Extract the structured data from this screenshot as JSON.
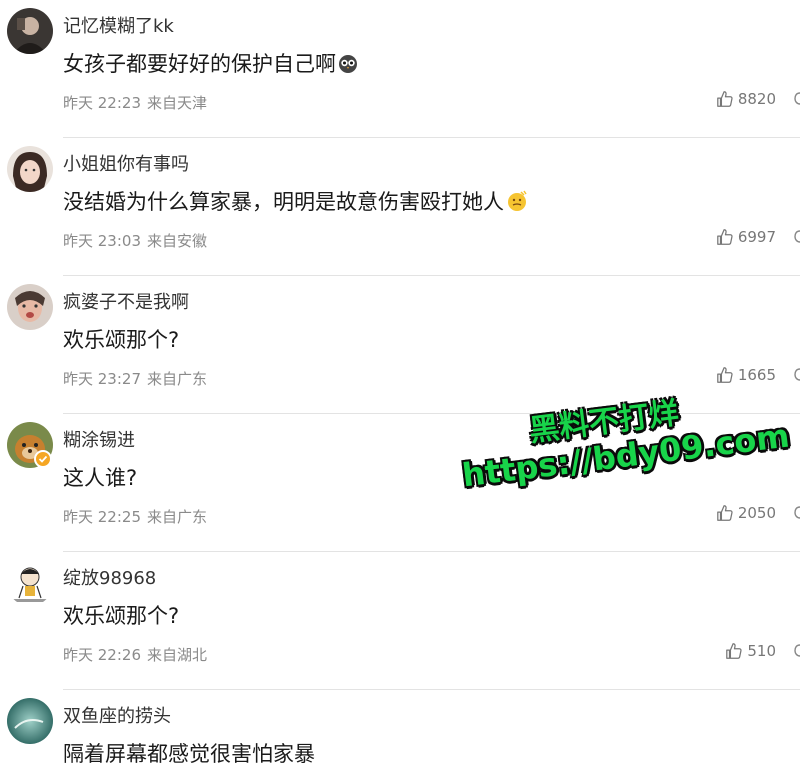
{
  "comments": [
    {
      "user": "记忆模糊了kk",
      "text": "女孩子都要好好的保护自己啊",
      "emoji": "emoji-owl-icon",
      "time": "昨天 22:23",
      "location": "来自天津",
      "likes": "8820"
    },
    {
      "user": "小姐姐你有事吗",
      "text": "没结婚为什么算家暴，明明是故意伤害殴打她人",
      "emoji": "emoji-thinking-icon",
      "time": "昨天 23:03",
      "location": "来自安徽",
      "likes": "6997"
    },
    {
      "user": "疯婆子不是我啊",
      "text": "欢乐颂那个?",
      "emoji": "",
      "time": "昨天 23:27",
      "location": "来自广东",
      "likes": "1665"
    },
    {
      "user": "糊涂锡进",
      "text": "这人谁?",
      "emoji": "",
      "time": "昨天 22:25",
      "location": "来自广东",
      "likes": "2050",
      "verified": true
    },
    {
      "user": "绽放98968",
      "text": "欢乐颂那个?",
      "emoji": "",
      "time": "昨天 22:26",
      "location": "来自湖北",
      "likes": "510"
    },
    {
      "user": "双鱼座的捞头",
      "text": "隔着屏幕都感觉很害怕家暴",
      "emoji": "",
      "time": "",
      "location": "",
      "likes": ""
    }
  ],
  "watermark": {
    "line1": "黑料不打烊",
    "line2": "https://bdy09.com"
  },
  "colors": {
    "watermark": "#18d44a",
    "divider": "#e3e3e3",
    "meta": "#8a8a8a"
  }
}
